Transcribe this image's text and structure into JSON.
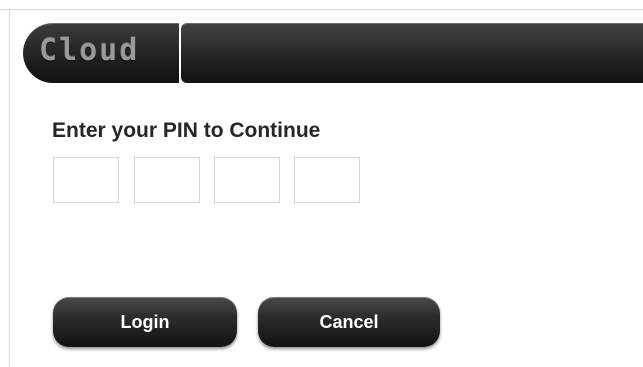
{
  "header": {
    "logo_text": "Cloud"
  },
  "login": {
    "prompt": "Enter your PIN to Continue",
    "pin_fields": [
      "",
      "",
      "",
      ""
    ],
    "login_label": "Login",
    "cancel_label": "Cancel"
  }
}
